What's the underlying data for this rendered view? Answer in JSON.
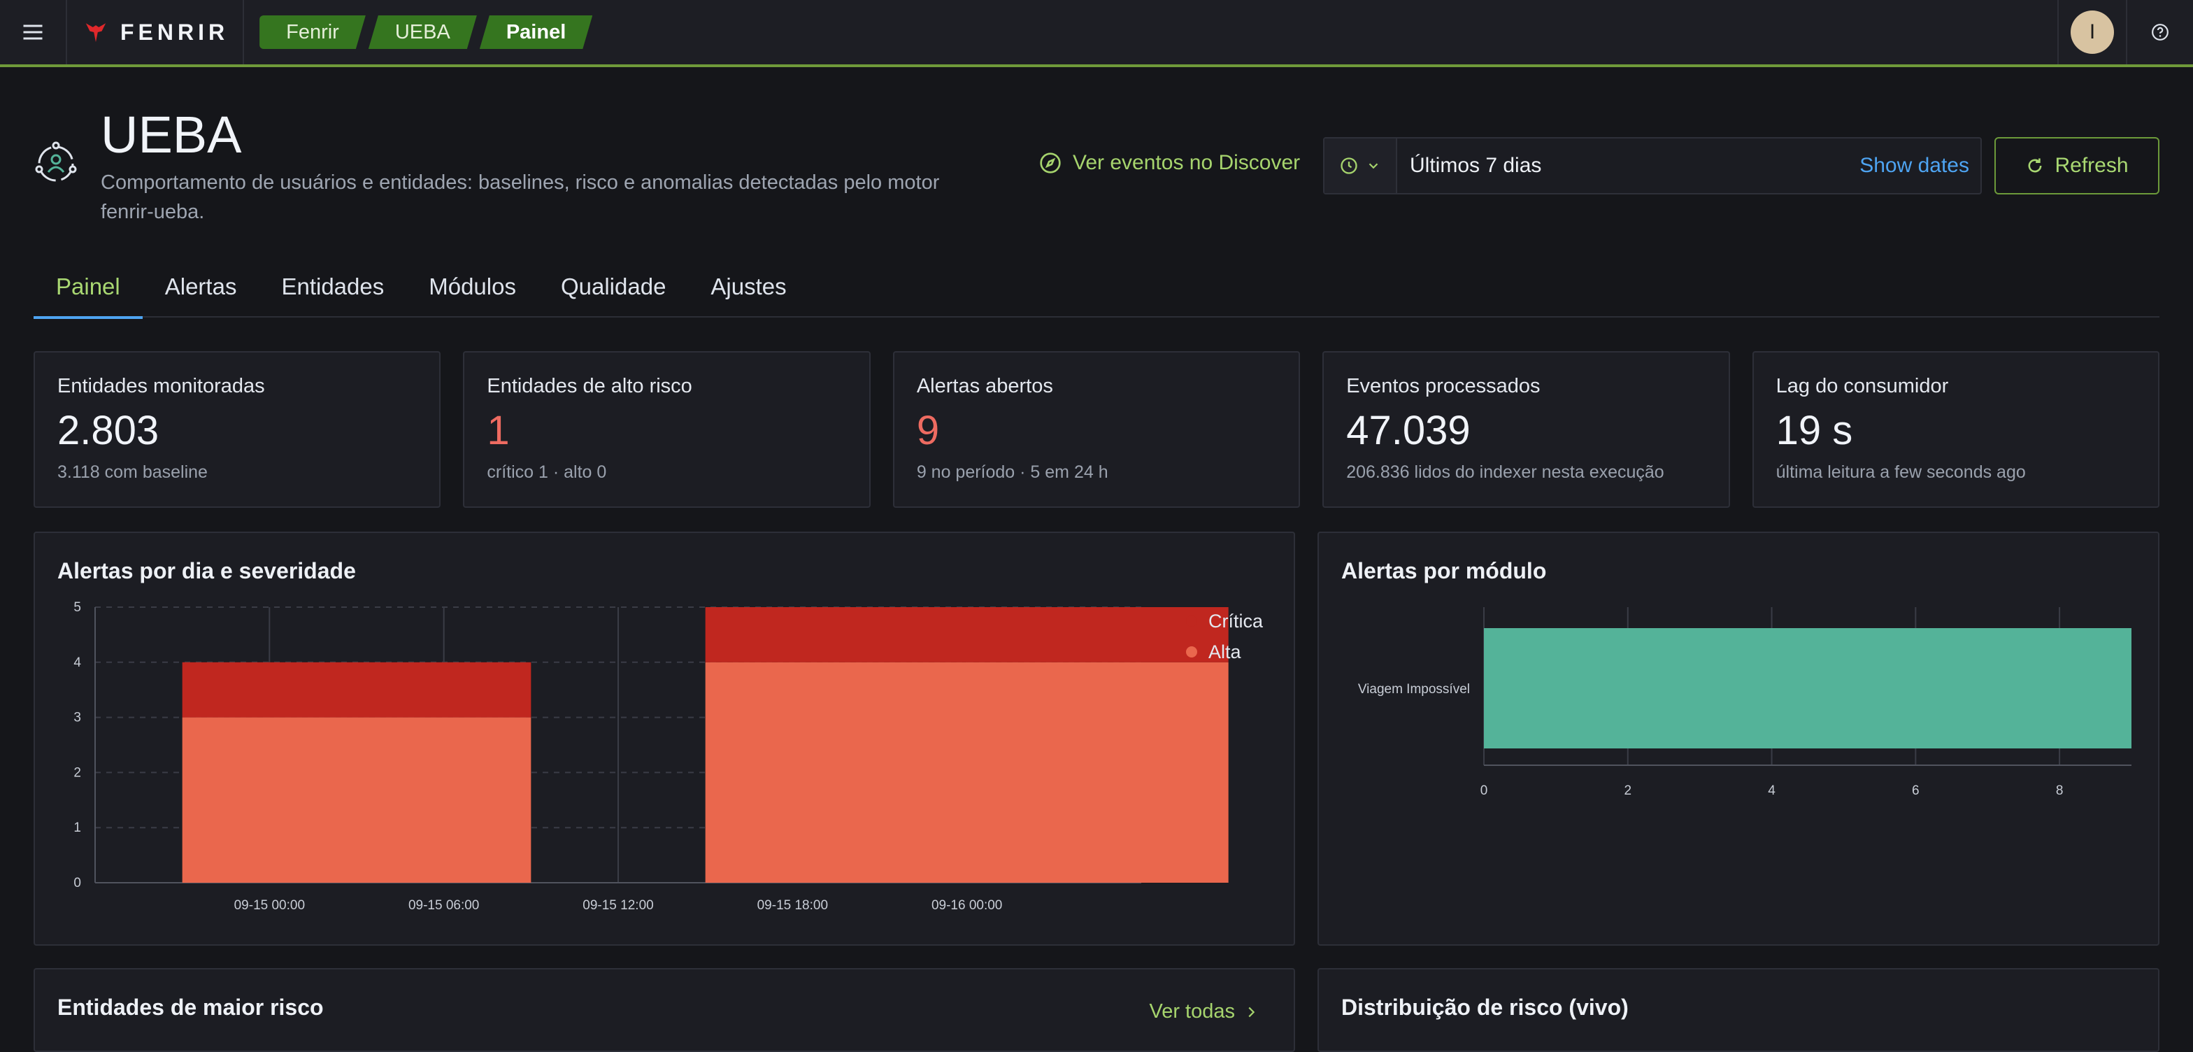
{
  "brand": {
    "name": "FENRIR"
  },
  "breadcrumbs": [
    {
      "label": "Fenrir"
    },
    {
      "label": "UEBA"
    },
    {
      "label": "Painel"
    }
  ],
  "user": {
    "initial": "I"
  },
  "header": {
    "title": "UEBA",
    "description": "Comportamento de usuários e entidades: baselines, risco e anomalias detectadas pelo motor fenrir-ueba.",
    "discover_label": "Ver eventos no Discover",
    "date_range": "Últimos 7 dias",
    "show_dates_label": "Show dates",
    "refresh_label": "Refresh"
  },
  "tabs": [
    {
      "label": "Painel",
      "active": true
    },
    {
      "label": "Alertas",
      "active": false
    },
    {
      "label": "Entidades",
      "active": false
    },
    {
      "label": "Módulos",
      "active": false
    },
    {
      "label": "Qualidade",
      "active": false
    },
    {
      "label": "Ajustes",
      "active": false
    }
  ],
  "stats": [
    {
      "label": "Entidades monitoradas",
      "value": "2.803",
      "sub": "3.118 com baseline",
      "danger": false
    },
    {
      "label": "Entidades de alto risco",
      "value": "1",
      "sub": "crítico 1 · alto 0",
      "danger": true
    },
    {
      "label": "Alertas abertos",
      "value": "9",
      "sub": "9 no período · 5 em 24 h",
      "danger": true
    },
    {
      "label": "Eventos processados",
      "value": "47.039",
      "sub": "206.836 lidos do indexer nesta execução",
      "danger": false
    },
    {
      "label": "Lag do consumidor",
      "value": "19 s",
      "sub": "última leitura a few seconds ago",
      "danger": false
    }
  ],
  "panels": {
    "severity_title": "Alertas por dia e severidade",
    "module_title": "Alertas por módulo",
    "top_entities_title": "Entidades de maior risco",
    "top_entities_link": "Ver todas",
    "risk_dist_title": "Distribuição de risco (vivo)"
  },
  "colors": {
    "accent": "#a9d872",
    "critical": "#c0271f",
    "high": "#ea674d",
    "module_bar": "#54b399",
    "link": "#4ea4f2"
  },
  "chart_data": [
    {
      "type": "bar",
      "stacked": true,
      "title": "Alertas por dia e severidade",
      "x_ticks": [
        "09-15 00:00",
        "09-15 06:00",
        "09-15 12:00",
        "09-15 18:00",
        "09-16 00:00"
      ],
      "bars": [
        {
          "start": "09-14 21:00",
          "end": "09-15 09:00",
          "values": {
            "Alta": 3,
            "Crítica": 1
          }
        },
        {
          "start": "09-15 15:00",
          "end": "09-16 09:00",
          "values": {
            "Alta": 4,
            "Crítica": 1
          }
        }
      ],
      "x_range": [
        "09-14 18:00",
        "09-16 06:00"
      ],
      "series": [
        {
          "name": "Crítica",
          "color": "#c0271f"
        },
        {
          "name": "Alta",
          "color": "#ea674d"
        }
      ],
      "ylim": [
        0,
        5
      ],
      "y_ticks": [
        0,
        1,
        2,
        3,
        4,
        5
      ],
      "grid": true,
      "legend": "top-right"
    },
    {
      "type": "bar",
      "orientation": "horizontal",
      "title": "Alertas por módulo",
      "categories": [
        "Viagem Impossível"
      ],
      "values": [
        9
      ],
      "xlim": [
        0,
        9
      ],
      "x_ticks": [
        0,
        2,
        4,
        6,
        8
      ],
      "color": "#54b399",
      "grid": true
    }
  ]
}
